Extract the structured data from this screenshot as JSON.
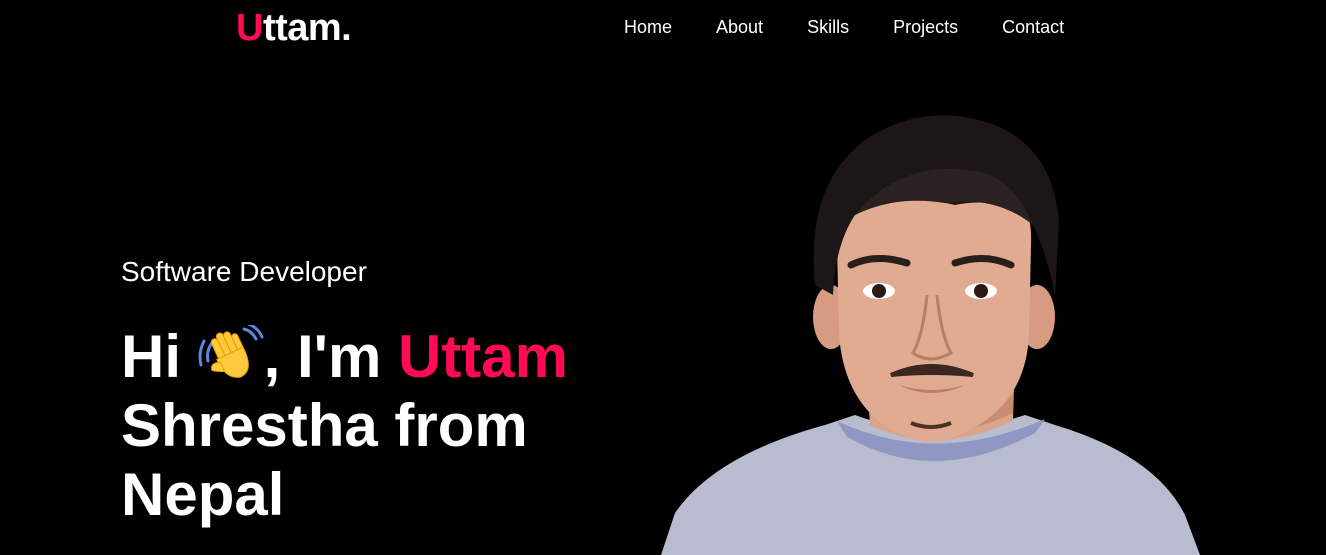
{
  "header": {
    "logo": {
      "accent_letter": "U",
      "rest": "ttam."
    },
    "nav": [
      {
        "label": "Home"
      },
      {
        "label": "About"
      },
      {
        "label": "Skills"
      },
      {
        "label": "Projects"
      },
      {
        "label": "Contact"
      }
    ]
  },
  "hero": {
    "role": "Software Developer",
    "greeting": "Hi",
    "wave_icon": "waving-hand-icon",
    "intro": ", I'm",
    "name_highlight": "Uttam",
    "rest_line1": "Shrestha from",
    "rest_line2": "Nepal"
  },
  "colors": {
    "background": "#000000",
    "accent": "#ff0a53",
    "text": "#ffffff"
  }
}
